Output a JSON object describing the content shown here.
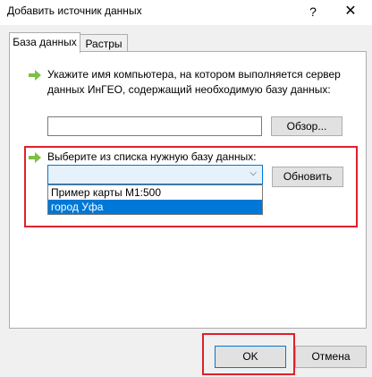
{
  "window": {
    "title": "Добавить источник данных",
    "help_label": "?",
    "close_label": "✕"
  },
  "tabs": [
    {
      "label": "База данных",
      "active": true
    },
    {
      "label": "Растры",
      "active": false
    }
  ],
  "server": {
    "instruction": "Укажите имя компьютера, на котором выполняется сервер данных ИнГЕО, содержащий необходимую базу данных:",
    "value": "",
    "browse_label": "Обзор..."
  },
  "database": {
    "instruction": "Выберите из списка нужную базу данных:",
    "selected_value": "",
    "options": [
      "Пример карты М1:500",
      "город Уфа"
    ],
    "highlighted_option": "город Уфа",
    "refresh_label": "Обновить"
  },
  "footer": {
    "ok_label": "OK",
    "cancel_label": "Отмена"
  },
  "colors": {
    "arrow_green": "#7cc142",
    "highlight_red": "#e0202b",
    "selection_blue": "#0078d7"
  }
}
